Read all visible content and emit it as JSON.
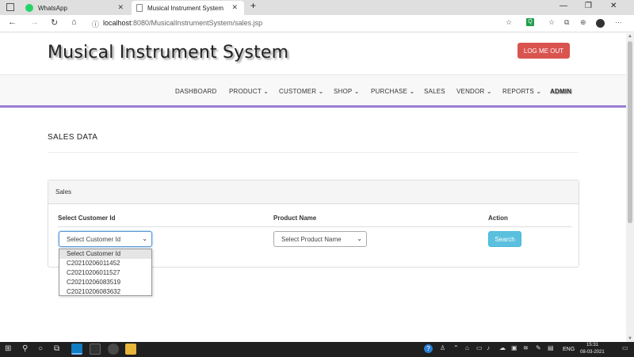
{
  "browser": {
    "tabs": [
      {
        "label": "WhatsApp",
        "active": false
      },
      {
        "label": "Musical Instrument System",
        "active": true
      }
    ],
    "new_tab": "+",
    "url_host": "localhost",
    "url_rest": ":8080/MusicalInstrumentSystem/sales.jsp"
  },
  "header": {
    "brand": "Musical Instrument System",
    "logout_label": "LOG ME OUT"
  },
  "nav": {
    "items": [
      {
        "label": "DASHBOARD"
      },
      {
        "label": "PRODUCT ⌄"
      },
      {
        "label": "CUSTOMER ⌄"
      },
      {
        "label": "SHOP ⌄"
      },
      {
        "label": "PURCHASE ⌄"
      },
      {
        "label": "SALES"
      },
      {
        "label": "VENDOR ⌄"
      },
      {
        "label": "REPORTS ⌄"
      },
      {
        "label": "ADMIN"
      }
    ]
  },
  "main": {
    "section_title": "SALES DATA",
    "panel_title": "Sales",
    "columns": [
      "Select Customer Id",
      "Product Name",
      "Action"
    ],
    "customer_select": {
      "value": "Select Customer Id",
      "options": [
        "Select Customer Id",
        "C20210206011452",
        "C20210206011527",
        "C20210206083519",
        "C20210206083632"
      ]
    },
    "product_select": {
      "value": "Select Product Name"
    },
    "search_label": "Search"
  },
  "taskbar": {
    "lang": "ENG",
    "time": "15:31",
    "date": "08-03-2021"
  },
  "colors": {
    "logout": "#d9534f",
    "nav_underline": "#9b7fd4",
    "search_button": "#5bc0de"
  }
}
